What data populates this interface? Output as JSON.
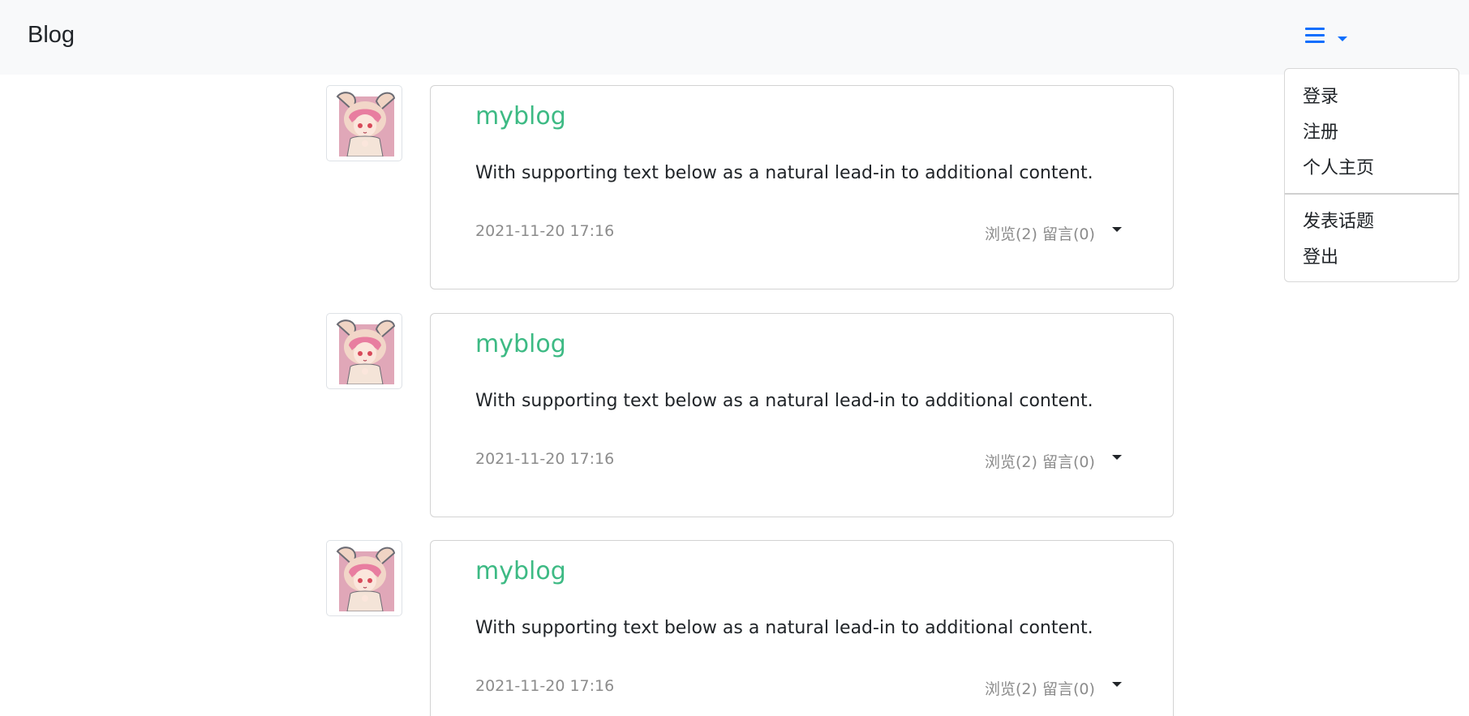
{
  "navbar": {
    "brand": "Blog",
    "menu_icon": "hamburger-icon",
    "caret_icon": "caret-down-icon",
    "accent_color": "#0d6efd",
    "background": "#f8f9fa"
  },
  "dropdown": {
    "items": [
      "登录",
      "注册",
      "个人主页",
      "发表话题",
      "登出"
    ]
  },
  "posts": [
    {
      "title": "myblog",
      "text": "With supporting text below as a natural lead-in to additional content.",
      "date": "2021-11-20 17:16",
      "stats": "浏览(2) 留言(0)",
      "avatar_icon": "anime-girl-avatar"
    },
    {
      "title": "myblog",
      "text": "With supporting text below as a natural lead-in to additional content.",
      "date": "2021-11-20 17:16",
      "stats": "浏览(2) 留言(0)",
      "avatar_icon": "anime-girl-avatar"
    },
    {
      "title": "myblog",
      "text": "With supporting text below as a natural lead-in to additional content.",
      "date": "2021-11-20 17:16",
      "stats": "浏览(2) 留言(0)",
      "avatar_icon": "anime-girl-avatar"
    }
  ],
  "colors": {
    "title": "#3dba84",
    "muted": "#8c8c8c",
    "text": "#212529"
  }
}
